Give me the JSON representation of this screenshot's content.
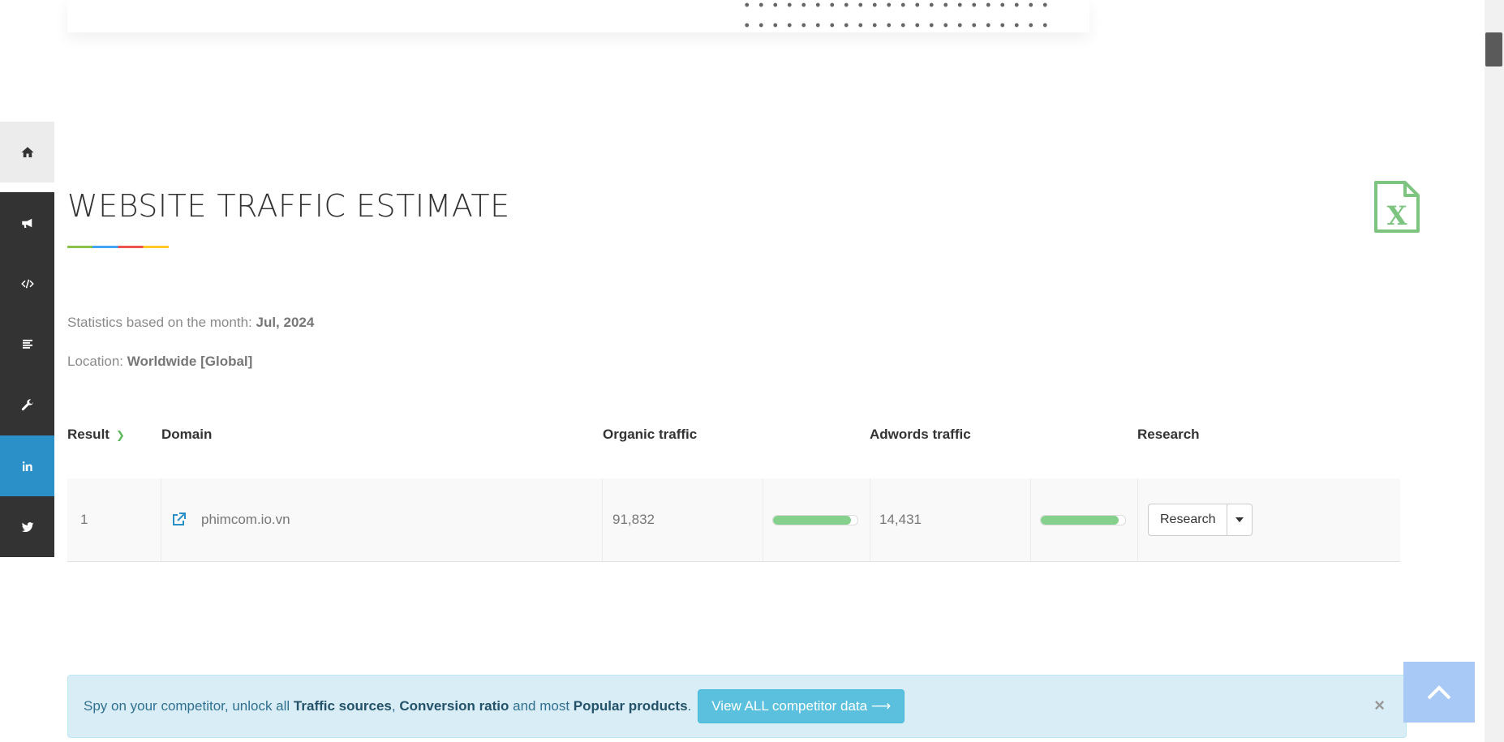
{
  "heading": {
    "title": "WEBSITE TRAFFIC ESTIMATE"
  },
  "stats": {
    "month_label": "Statistics based on the month:",
    "month_value": "Jul, 2024",
    "location_label": "Location:",
    "location_value": "Worldwide [Global]"
  },
  "table": {
    "headers": {
      "result": "Result",
      "domain": "Domain",
      "organic": "Organic traffic",
      "adwords": "Adwords traffic",
      "research": "Research"
    },
    "rows": [
      {
        "result": "1",
        "domain": "phimcom.io.vn",
        "organic": "91,832",
        "organic_bar": 0.92,
        "adwords": "14,431",
        "adwords_bar": 0.92,
        "research_label": "Research"
      }
    ]
  },
  "alert": {
    "text1": "Spy on your competitor, unlock all ",
    "bold1": "Traffic sources",
    "sep1": ", ",
    "bold2": "Conversion ratio",
    "text2": " and most ",
    "bold3": "Popular products",
    "text3": ".",
    "button": "View ALL competitor data ⟶",
    "close": "×"
  },
  "icons": {
    "sidebar": [
      "home-icon",
      "bullhorn-icon",
      "code-icon",
      "align-left-icon",
      "wrench-icon",
      "linkedin-icon",
      "twitter-icon"
    ],
    "export": "excel-file-icon"
  },
  "colors": {
    "accent_green": "#5cb85c",
    "bar_green": "#86d08d",
    "linkedin": "#2b8fc8",
    "alert_bg": "#d9edf7",
    "alert_button": "#5bc0de"
  }
}
